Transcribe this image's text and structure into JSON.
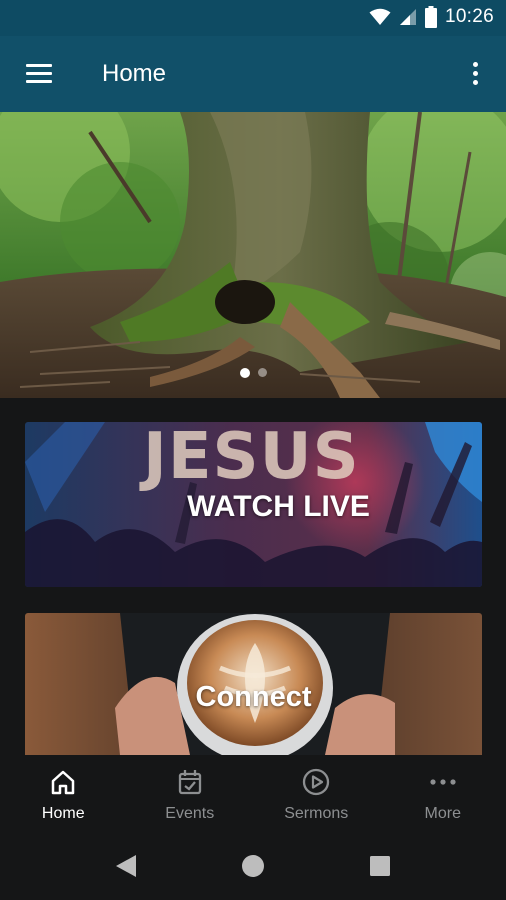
{
  "status_bar": {
    "time": "10:26",
    "icons": [
      "wifi-icon",
      "cell-signal-icon",
      "battery-icon"
    ]
  },
  "app_bar": {
    "title": "Home",
    "menu_icon": "hamburger-menu-icon",
    "overflow_icon": "more-vertical-icon",
    "background": "#115069"
  },
  "hero": {
    "image": "mossy tree trunk in a forest",
    "carousel": {
      "count": 2,
      "active": 1
    }
  },
  "cards": [
    {
      "id": "watch-live",
      "label": "WATCH LIVE",
      "background_text": "JESUS",
      "image": "worship concert with raised hands"
    },
    {
      "id": "connect",
      "label": "Connect",
      "image": "hands holding latte art coffee cup"
    }
  ],
  "bottom_nav": {
    "items": [
      {
        "label": "Home",
        "icon": "home-icon",
        "active": true
      },
      {
        "label": "Events",
        "icon": "calendar-check-icon",
        "active": false
      },
      {
        "label": "Sermons",
        "icon": "play-circle-icon",
        "active": false
      },
      {
        "label": "More",
        "icon": "more-horizontal-icon",
        "active": false
      }
    ]
  },
  "system_nav": {
    "icons": [
      "back-icon",
      "home-circle-icon",
      "recents-icon"
    ]
  },
  "colors": {
    "status_bar": "#0e4b63",
    "app_bar": "#115069",
    "background": "#151617",
    "nav_inactive": "#8d8f91"
  }
}
